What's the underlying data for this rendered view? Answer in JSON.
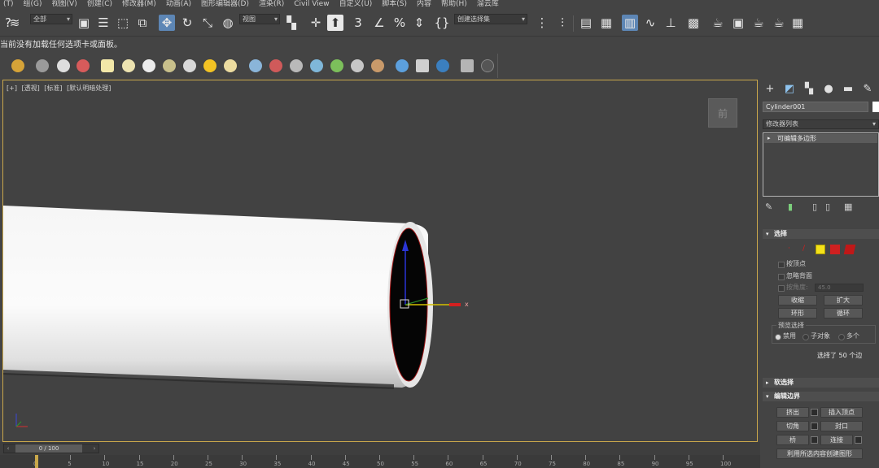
{
  "menu": [
    "(T)",
    "组(G)",
    "视图(V)",
    "创建(C)",
    "修改器(M)",
    "动画(A)",
    "图形编辑器(D)",
    "渲染(R)",
    "Civil View",
    "自定义(U)",
    "脚本(S)",
    "内容",
    "帮助(H)",
    "溜云库"
  ],
  "toolbar": {
    "selection_filter": "全部",
    "ref_coord": "视图",
    "named_selection": "创建选择集"
  },
  "notice": "当前没有加载任何选项卡或面板。",
  "viewport": {
    "labels": [
      "[+]",
      "[透视]",
      "[标准]",
      "[默认明暗处理]"
    ],
    "viewcube_face": "前",
    "axis_x": "x"
  },
  "command_panel": {
    "object_name": "Cylinder001",
    "modifier_list": "修改器列表",
    "stack_item": "可编辑多边形",
    "selection_rollout": "选择",
    "by_vertex": "按顶点",
    "ignore_backfacing": "忽略背面",
    "by_angle": "按角度:",
    "angle_value": "45.0",
    "shrink": "收缩",
    "grow": "扩大",
    "ring": "环形",
    "loop": "循环",
    "preview_selection": "预览选择",
    "radio_disabled": "禁用",
    "radio_subobject": "子对象",
    "radio_multi": "多个",
    "selection_count": "选择了 50 个边",
    "soft_selection": "软选择",
    "edit_edges": "编辑边界",
    "extrude": "挤出",
    "insert_vertex": "插入顶点",
    "chamfer": "切角",
    "cap": "封口",
    "bridge": "桥",
    "connect": "连接",
    "create_shape": "利用所选内容创建图形"
  },
  "timeline": {
    "frame_display": "0 / 100",
    "ticks": [
      "0",
      "5",
      "10",
      "15",
      "20",
      "25",
      "30",
      "35",
      "40",
      "45",
      "50",
      "55",
      "60",
      "65",
      "70",
      "75",
      "80",
      "85",
      "90",
      "95",
      "100"
    ]
  }
}
